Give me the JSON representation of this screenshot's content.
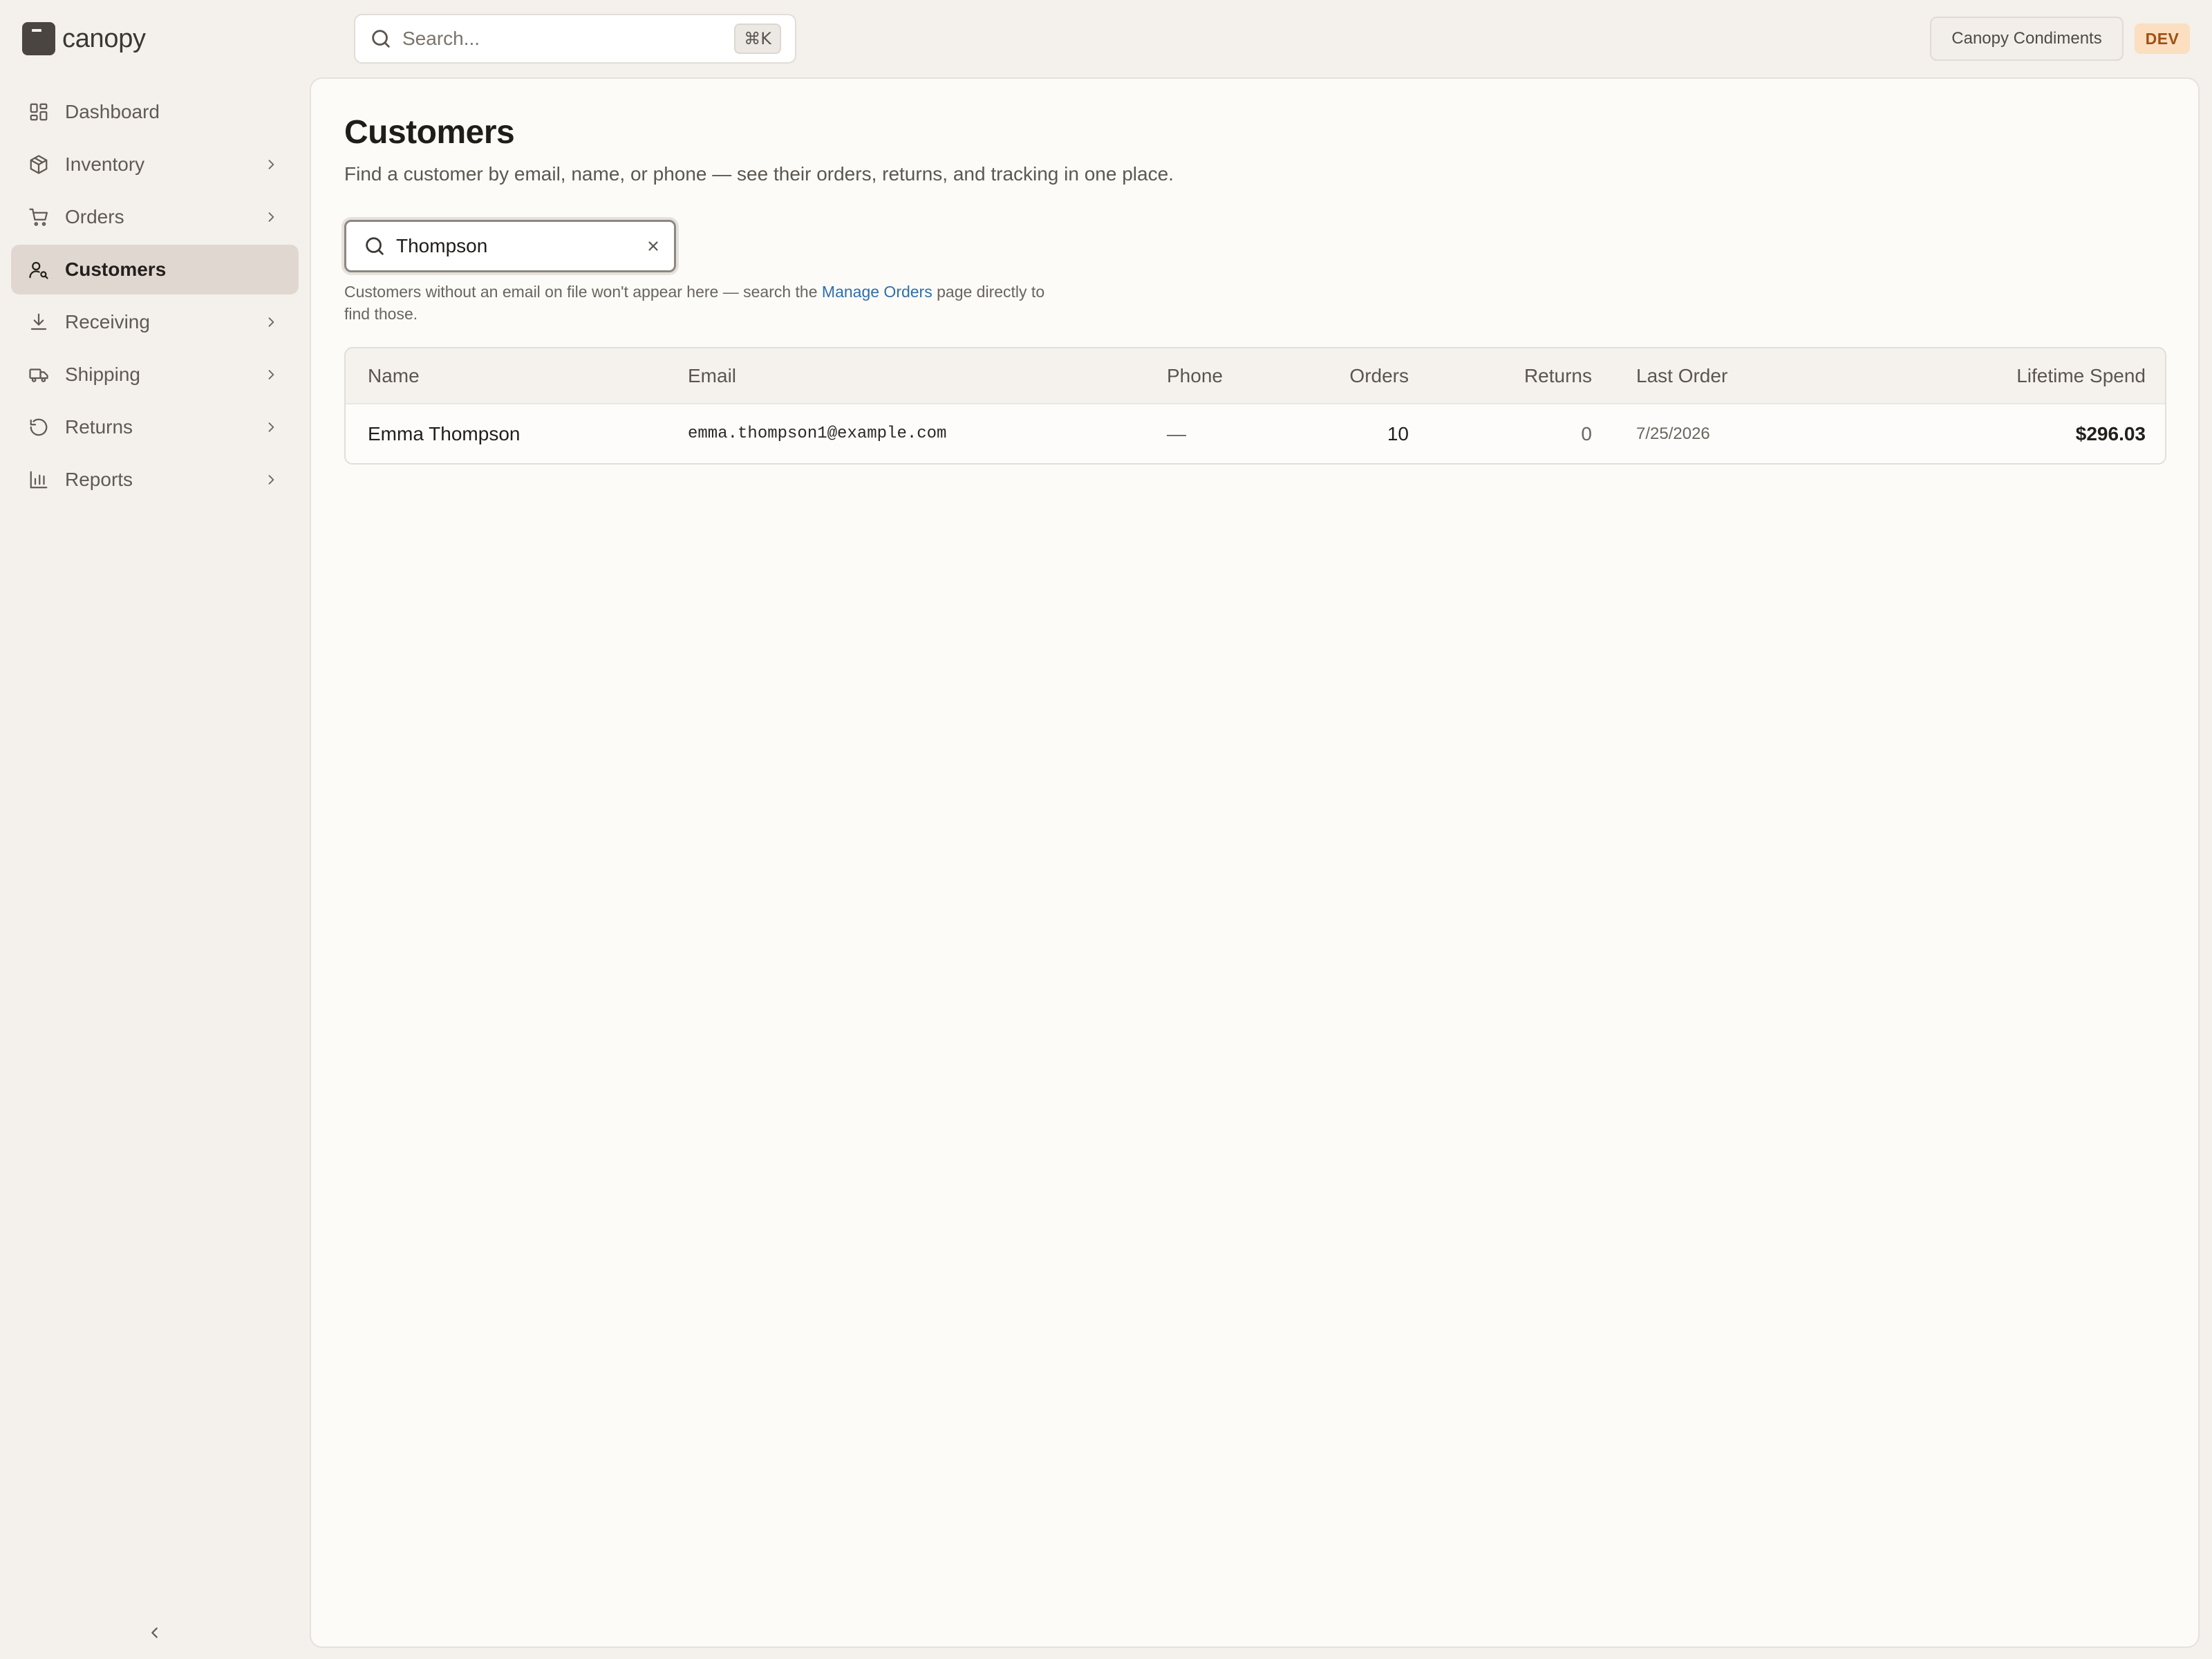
{
  "brand": {
    "name": "canopy"
  },
  "topbar": {
    "search_placeholder": "Search...",
    "search_shortcut": "⌘K",
    "org_name": "Canopy Condiments",
    "env_badge": "DEV"
  },
  "sidebar": {
    "items": [
      {
        "label": "Dashboard",
        "icon": "dashboard-icon",
        "has_children": false,
        "active": false
      },
      {
        "label": "Inventory",
        "icon": "package-icon",
        "has_children": true,
        "active": false
      },
      {
        "label": "Orders",
        "icon": "cart-icon",
        "has_children": true,
        "active": false
      },
      {
        "label": "Customers",
        "icon": "user-search-icon",
        "has_children": false,
        "active": true
      },
      {
        "label": "Receiving",
        "icon": "download-icon",
        "has_children": true,
        "active": false
      },
      {
        "label": "Shipping",
        "icon": "truck-icon",
        "has_children": true,
        "active": false
      },
      {
        "label": "Returns",
        "icon": "rotate-ccw-icon",
        "has_children": true,
        "active": false
      },
      {
        "label": "Reports",
        "icon": "bar-chart-icon",
        "has_children": true,
        "active": false
      }
    ],
    "collapse_icon": "chevron-left-icon"
  },
  "page": {
    "title": "Customers",
    "subtitle": "Find a customer by email, name, or phone — see their orders, returns, and tracking in one place.",
    "search_value": "Thompson",
    "hint_before": "Customers without an email on file won't appear here — search the ",
    "hint_link": "Manage Orders",
    "hint_after": " page directly to find those."
  },
  "table": {
    "columns": [
      "Name",
      "Email",
      "Phone",
      "Orders",
      "Returns",
      "Last Order",
      "Lifetime Spend"
    ],
    "rows": [
      {
        "name": "Emma Thompson",
        "email": "emma.thompson1@example.com",
        "phone": "—",
        "orders": "10",
        "returns": "0",
        "last_order": "7/25/2026",
        "lifetime_spend": "$296.03"
      }
    ]
  }
}
